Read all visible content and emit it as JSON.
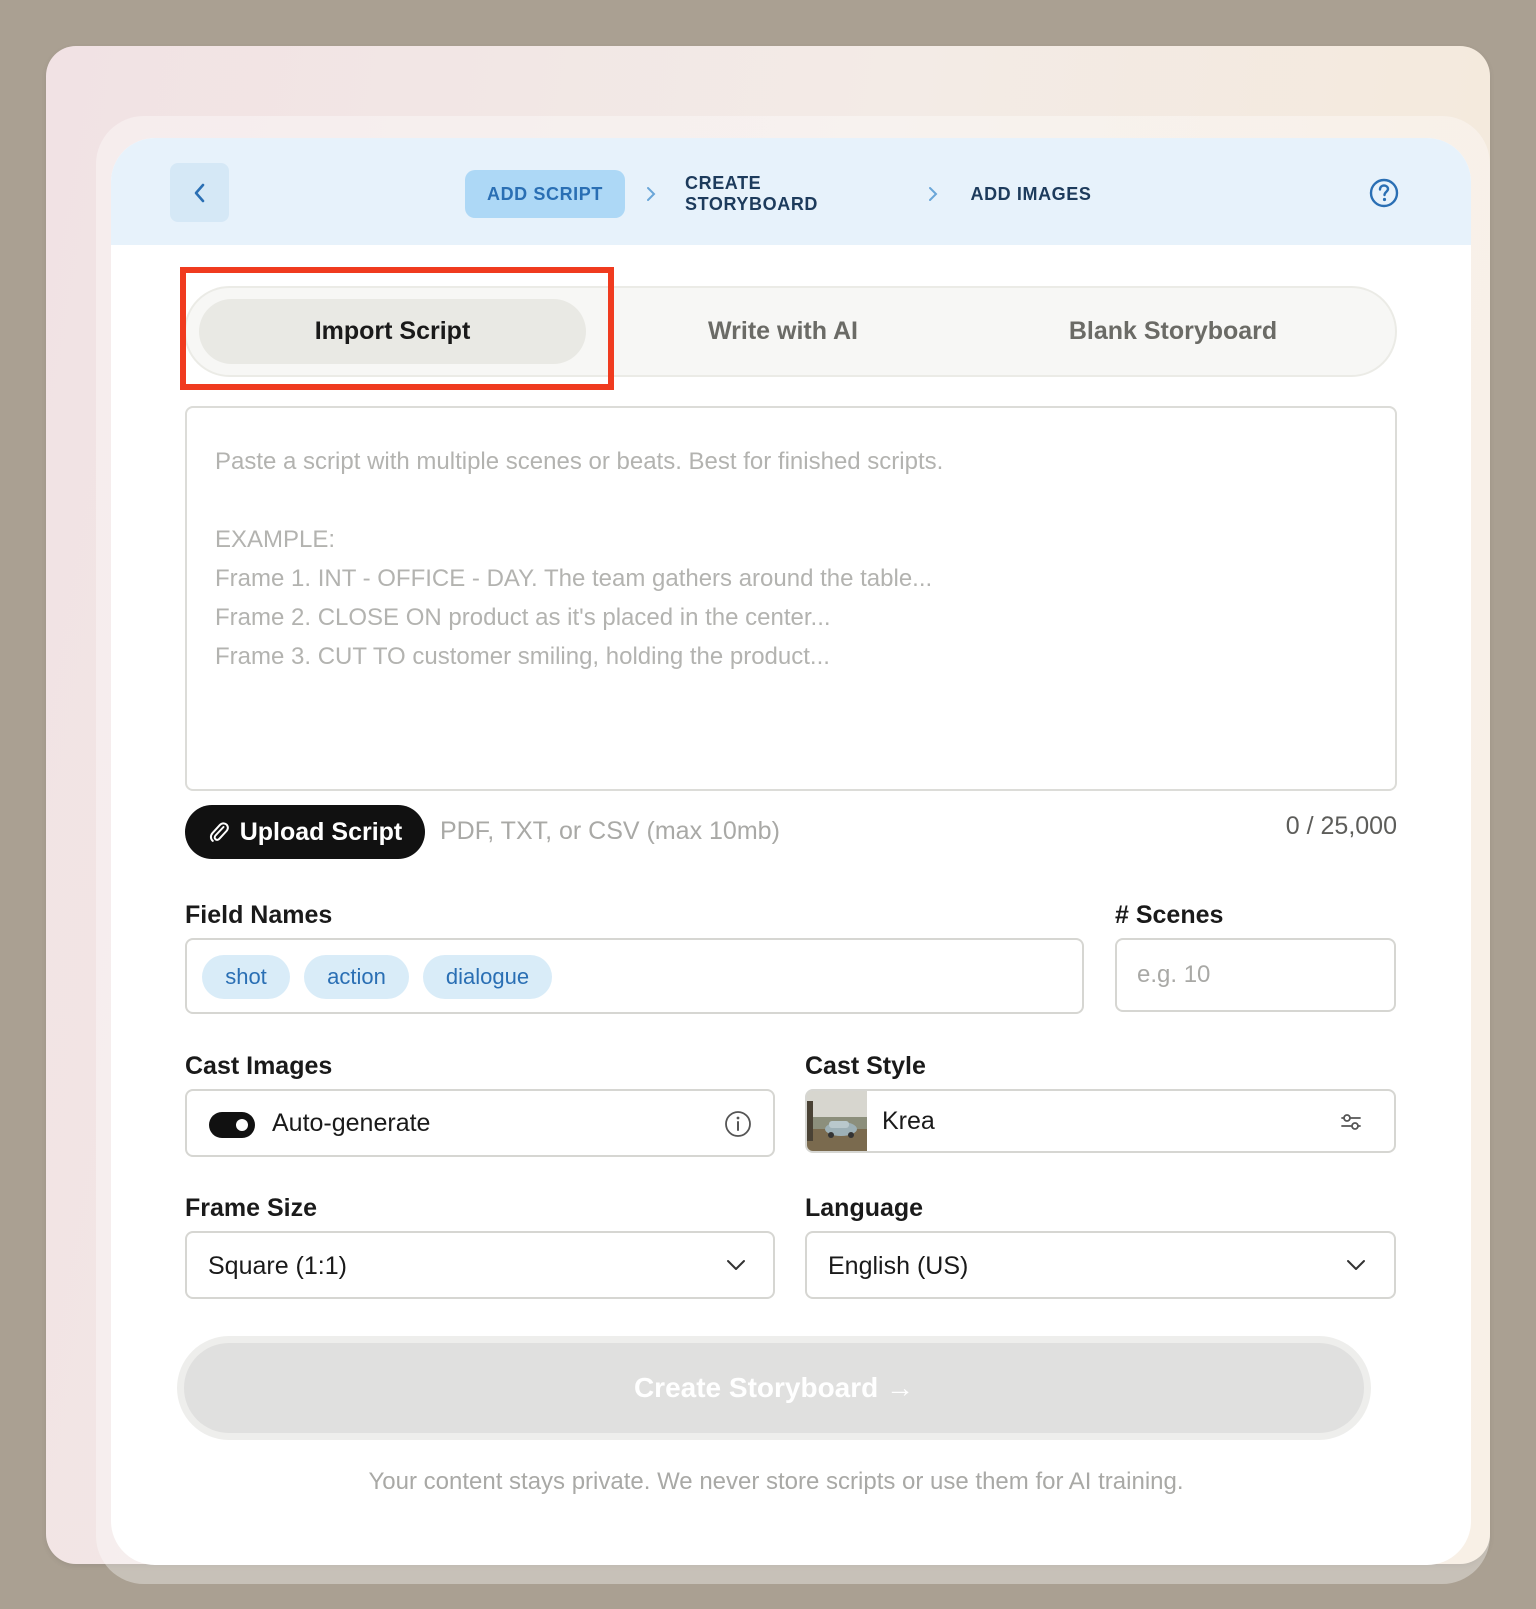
{
  "nav": {
    "steps": [
      "ADD SCRIPT",
      "CREATE STORYBOARD",
      "ADD IMAGES"
    ],
    "active_step": "ADD SCRIPT",
    "back_icon": "chevron-left-icon",
    "help_icon": "question-circle-icon"
  },
  "tabs": [
    "Import Script",
    "Write with AI",
    "Blank Storyboard"
  ],
  "active_tab": "Import Script",
  "script_input": {
    "placeholder_lines": [
      "Paste a script with multiple scenes or beats. Best for finished scripts.",
      "",
      "EXAMPLE:",
      "Frame 1. INT - OFFICE - DAY. The team gathers around the table...",
      "Frame 2. CLOSE ON product as it's placed in the center...",
      "Frame 3. CUT TO customer smiling, holding the product..."
    ],
    "value": ""
  },
  "upload": {
    "button_label": "Upload Script",
    "hint": "PDF, TXT, or CSV (max 10mb)",
    "counter": "0 / 25,000",
    "icon": "paperclip-icon"
  },
  "field_names": {
    "label": "Field Names",
    "tags": [
      "shot",
      "action",
      "dialogue"
    ]
  },
  "scenes": {
    "label": "# Scenes",
    "placeholder": "e.g. 10"
  },
  "cast_images": {
    "label": "Cast Images",
    "option": "Auto-generate",
    "toggle_on": true,
    "icon": "info-icon"
  },
  "cast_style": {
    "label": "Cast Style",
    "value": "Krea",
    "icon": "sliders-icon"
  },
  "frame_size": {
    "label": "Frame Size",
    "value": "Square (1:1)"
  },
  "language": {
    "label": "Language",
    "value": "English (US)"
  },
  "create_button": "Create Storyboard →",
  "privacy_note": "Your content stays private. We never store scripts or use them for AI training.",
  "colors": {
    "accent_blue": "#2a6fb4",
    "active_step_bg": "#add8f6",
    "highlight_red": "#f03b1f"
  }
}
